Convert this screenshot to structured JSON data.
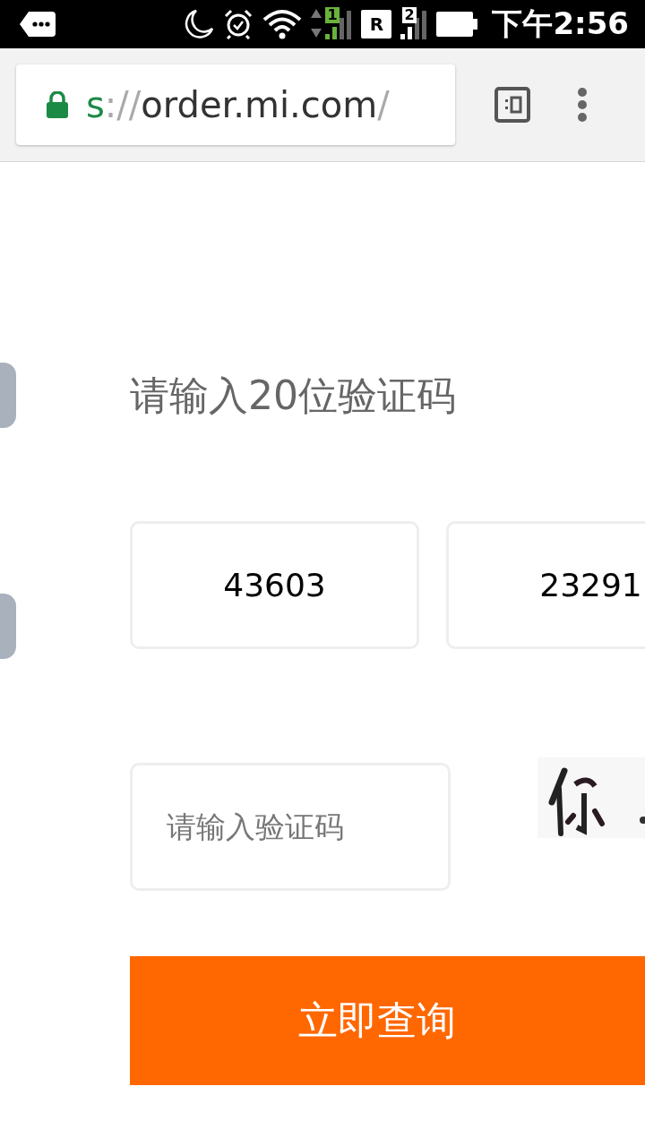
{
  "status_bar": {
    "sim1": "1",
    "roaming": "R",
    "sim2": "2",
    "time": "下午2:56"
  },
  "address_bar": {
    "url": {
      "scheme": "s",
      "separator": "://",
      "host": "order.mi.com",
      "path": "/"
    }
  },
  "form": {
    "title": "请输入20位验证码",
    "code_fields": [
      {
        "value": "43603"
      },
      {
        "value": "23291"
      }
    ],
    "captcha_field": {
      "placeholder": "请输入验证码"
    },
    "submit": "立即查询"
  }
}
